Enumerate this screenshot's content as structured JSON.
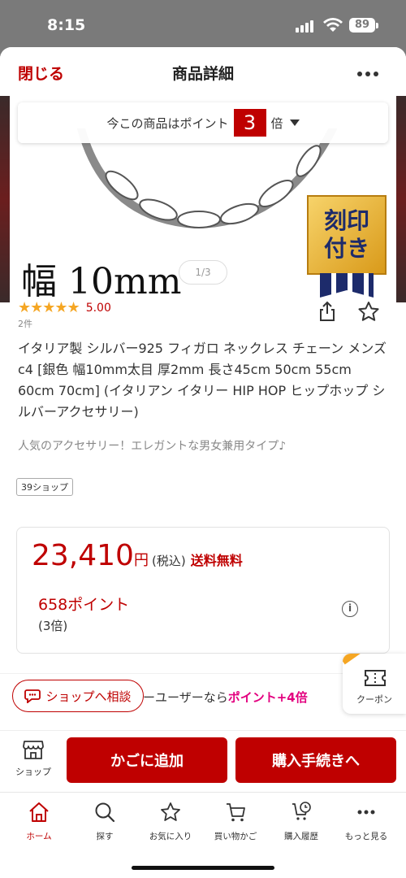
{
  "status_bar": {
    "time": "8:15",
    "battery": "89"
  },
  "header": {
    "close_label": "閉じる",
    "title": "商品詳細"
  },
  "points_banner": {
    "prefix": "今この商品はポイント",
    "multiplier": "3",
    "suffix": "倍"
  },
  "hero": {
    "width_label": "幅 10mm",
    "badge_line1": "刻印",
    "badge_line2": "付き",
    "pager": "1/3"
  },
  "product": {
    "stars": "★★★★★",
    "rating": "5.00",
    "review_count": "2件",
    "title": "イタリア製 シルバー925 フィガロ ネックレス チェーン メンズ c4 [銀色 幅10mm太目 厚2mm 長さ45cm 50cm 55cm 60cm 70cm] (イタリアン イタリー HIP HOP ヒップホップ シルバーアクセサリー)",
    "catch_copy": "人気のアクセサリー！エレガントな男女兼用タイプ♪",
    "shop_tag": "39ショップ"
  },
  "price": {
    "amount": "23,410",
    "yen": "円",
    "tax": "(税込)",
    "shipping": "送料無料",
    "points": "658ポイント",
    "points_rate": "(3倍)"
  },
  "promo": {
    "consult_label": "ショップへ相談",
    "text_prefix": "ーユーザーなら",
    "text_highlight": "ポイント+4倍",
    "coupon_label": "クーポン"
  },
  "actions": {
    "shop_label": "ショップ",
    "add_to_cart": "かごに追加",
    "checkout": "購入手続きへ"
  },
  "tabs": [
    {
      "label": "ホーム",
      "icon": "home-icon",
      "active": true
    },
    {
      "label": "探す",
      "icon": "search-icon"
    },
    {
      "label": "お気に入り",
      "icon": "star-icon"
    },
    {
      "label": "買い物かご",
      "icon": "cart-icon"
    },
    {
      "label": "購入履歴",
      "icon": "history-icon"
    },
    {
      "label": "もっと見る",
      "icon": "more-icon"
    }
  ],
  "colors": {
    "brand_red": "#bf0000",
    "star": "#f5a623",
    "highlight_pink": "#e3007f"
  }
}
